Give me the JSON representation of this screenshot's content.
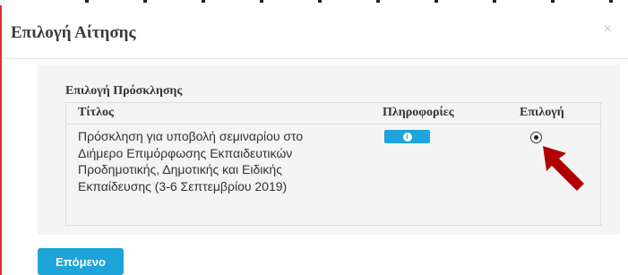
{
  "modal": {
    "title": "Επιλογή Αίτησης",
    "close_symbol": "×"
  },
  "section": {
    "title": "Επιλογή Πρόσκλησης"
  },
  "table": {
    "headers": [
      "Τίτλος",
      "Πληροφορίες",
      "Επιλογή"
    ],
    "rows": [
      {
        "title": "Πρόσκληση για υποβολή σεμιναρίου στο Διήμερο Επιμόρφωσης Εκπαιδευτικών Προδημοτικής, Δημοτικής και Ειδικής Εκπαίδευσης (3-6 Σεπτεμβρίου 2019)",
        "info_icon": "info-icon",
        "selected": true
      }
    ]
  },
  "footer": {
    "next_label": "Επόμενο"
  },
  "colors": {
    "accent": "#1ea4d8",
    "arrow": "#b10000",
    "border_accent": "#e03030"
  }
}
